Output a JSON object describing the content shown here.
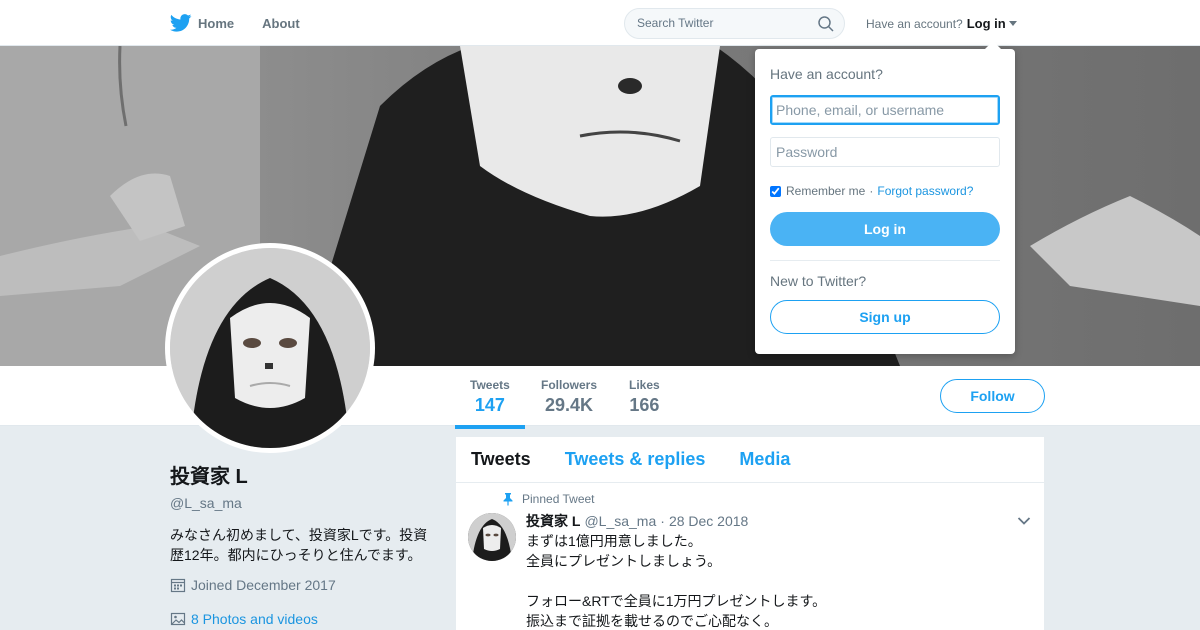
{
  "nav": {
    "home_label": "Home",
    "about_label": "About",
    "search_placeholder": "Search Twitter",
    "have_account_text": "Have an account?",
    "login_link": "Log in"
  },
  "profile_stats": [
    {
      "label": "Tweets",
      "value": "147"
    },
    {
      "label": "Followers",
      "value": "29.4K"
    },
    {
      "label": "Likes",
      "value": "166"
    }
  ],
  "follow_label": "Follow",
  "profile": {
    "name": "投資家 L",
    "handle": "@L_sa_ma",
    "bio": "みなさん初めまして、投資家Lです。投資歴12年。都内にひっそりと住んでます。",
    "joined": "Joined December 2017",
    "photos_link": "8 Photos and videos"
  },
  "timeline": {
    "tabs": [
      "Tweets",
      "Tweets & replies",
      "Media"
    ],
    "pinned_label": "Pinned Tweet",
    "tweet": {
      "name": "投資家 L",
      "handle": "@L_sa_ma",
      "dot": "·",
      "date": "28 Dec 2018",
      "lines": [
        "まずは1億円用意しました。",
        "全員にプレゼントしましょう。",
        "",
        "フォロー&RTで全員に1万円プレゼントします。",
        "振込まで証拠を載せるのでご心配なく。"
      ]
    }
  },
  "login_dropdown": {
    "title": "Have an account?",
    "username_placeholder": "Phone, email, or username",
    "password_placeholder": "Password",
    "remember_label": "Remember me",
    "separator": "·",
    "forgot_label": "Forgot password?",
    "login_button": "Log in",
    "new_text": "New to Twitter?",
    "signup_button": "Sign up"
  },
  "colors": {
    "accent": "#1da1f2",
    "login_button_bg": "#4ab3f4",
    "page_bg": "#e6ecf0"
  },
  "icons": [
    "twitter-bird-icon",
    "search-icon",
    "caret-down-icon",
    "pin-icon",
    "calendar-icon",
    "image-icon",
    "chevron-down-icon"
  ]
}
